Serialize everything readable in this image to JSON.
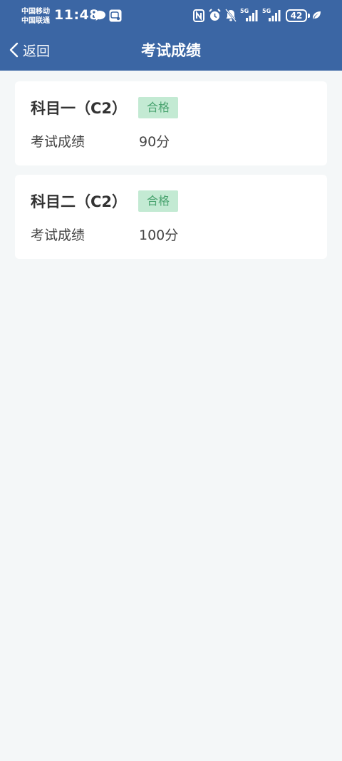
{
  "status_bar": {
    "carrier_1": "中国移动",
    "carrier_2": "中国联通",
    "time": "11:48",
    "net_1": "5G",
    "net_2": "5G",
    "battery": "42",
    "icons": [
      "chat-bubble-icon",
      "message-app-icon",
      "nfc-icon",
      "alarm-icon",
      "mute-bell-icon",
      "signal-icon",
      "signal-icon",
      "battery-icon",
      "leaf-icon"
    ]
  },
  "nav": {
    "back_label": "返回",
    "title": "考试成绩"
  },
  "results": [
    {
      "subject": "科目一（C2）",
      "status": "合格",
      "score_label": "考试成绩",
      "score": "90分"
    },
    {
      "subject": "科目二（C2）",
      "status": "合格",
      "score_label": "考试成绩",
      "score": "100分"
    }
  ],
  "colors": {
    "header": "#3b66a4",
    "background": "#f4f7f8",
    "pass_badge_bg": "#c3ead3",
    "pass_badge_text": "#4aa470"
  }
}
